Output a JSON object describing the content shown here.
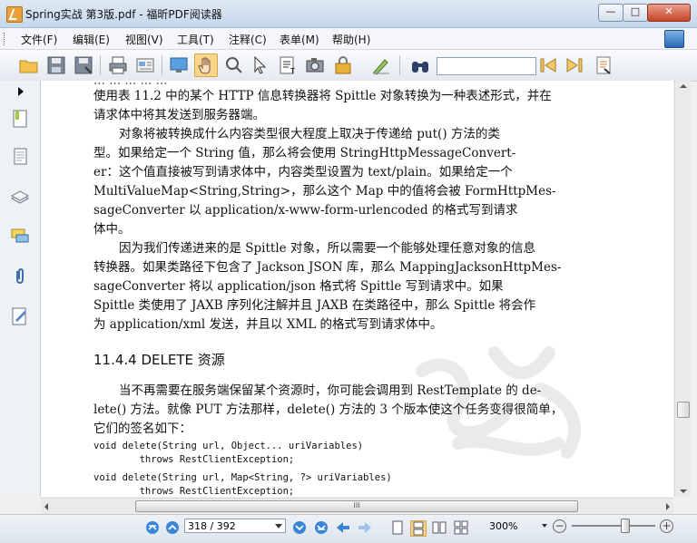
{
  "window": {
    "title": "Spring实战 第3版.pdf - 福昕PDF阅读器",
    "minimize": "—",
    "maximize": "□",
    "close": "✕"
  },
  "menu": {
    "items": [
      "文件(F)",
      "编辑(E)",
      "视图(V)",
      "工具(T)",
      "注释(C)",
      "表单(M)",
      "帮助(H)"
    ]
  },
  "toolbar": {
    "search_value": ""
  },
  "document": {
    "para1": [
      "使用表 11.2 中的某个 HTTP 信息转换器将 Spittle 对象转换为一种表述形式，并在",
      "请求体中将其发送到服务器端。"
    ],
    "para2": [
      "对象将被转换成什么内容类型很大程度上取决于传递给 put() 方法的类",
      "型。如果给定一个 String 值，那么将会使用 StringHttpMessageConvert-",
      "er：这个值直接被写到请求体中，内容类型设置为 text/plain。如果给定一个",
      "MultiValueMap<String,String>，那么这个 Map 中的值将会被 FormHttpMes-",
      "sageConverter 以 application/x-www-form-urlencoded 的格式写到请求",
      "体中。"
    ],
    "para3": [
      "因为我们传递进来的是 Spittle 对象，所以需要一个能够处理任意对象的信息",
      "转换器。如果类路径下包含了 Jackson JSON 库，那么 MappingJacksonHttpMes-",
      "sageConverter 将以 application/json 格式将 Spittle 写到请求中。如果",
      "Spittle 类使用了 JAXB 序列化注解并且 JAXB 在类路径中，那么 Spittle 将会作",
      "为 application/xml 发送，并且以 XML 的格式写到请求体中。"
    ],
    "heading": "11.4.4   DELETE 资源",
    "para4": [
      "当不再需要在服务端保留某个资源时，你可能会调用到 RestTemplate 的 de-",
      "lete() 方法。就像 PUT 方法那样，delete() 方法的 3 个版本使这个任务变得很简单，",
      "它们的签名如下："
    ],
    "code": [
      "void delete(String url, Object... uriVariables)",
      "        throws RestClientException;",
      "void delete(String url, Map<String, ?> uriVariables)",
      "        throws RestClientException;"
    ]
  },
  "hscroll": {
    "grip": "III"
  },
  "status": {
    "page": "318 / 392",
    "zoom": "300%",
    "zoom_out": "−",
    "zoom_in": "+",
    "zoom_level_percent": 60
  }
}
